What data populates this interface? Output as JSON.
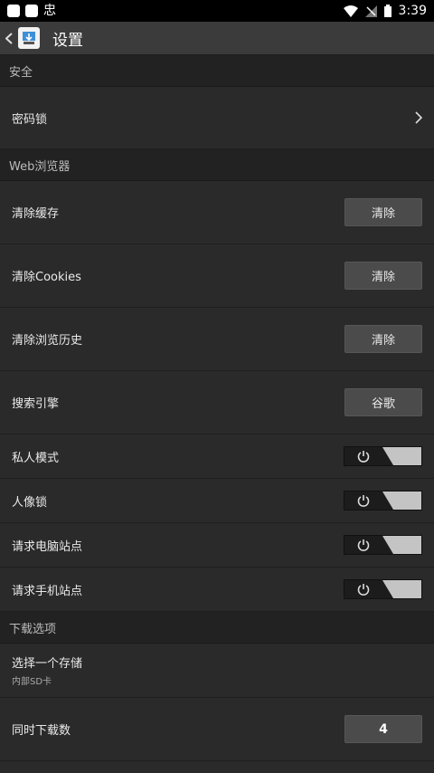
{
  "status_bar": {
    "time": "3:39",
    "notification_glyph": "忠"
  },
  "toolbar": {
    "title": "设置"
  },
  "sections": {
    "security": {
      "header": "安全",
      "password_lock": "密码锁"
    },
    "browser": {
      "header": "Web浏览器",
      "clear_cache": {
        "label": "清除缓存",
        "button": "清除"
      },
      "clear_cookies": {
        "label": "清除Cookies",
        "button": "清除"
      },
      "clear_history": {
        "label": "清除浏览历史",
        "button": "清除"
      },
      "search_engine": {
        "label": "搜索引擎",
        "button": "谷歌"
      },
      "private_mode": {
        "label": "私人模式"
      },
      "portrait_lock": {
        "label": "人像锁"
      },
      "request_desktop": {
        "label": "请求电脑站点"
      },
      "request_mobile": {
        "label": "请求手机站点"
      }
    },
    "download": {
      "header": "下载选项",
      "storage": {
        "label": "选择一个存储",
        "value": "内部SD卡"
      },
      "concurrent": {
        "label": "同时下载数",
        "value": "4"
      }
    }
  },
  "icons": [
    "back-arrow-icon",
    "app-download-icon",
    "chevron-right-icon",
    "power-icon",
    "wifi-icon",
    "signal-icon",
    "battery-icon"
  ],
  "colors": {
    "background": "#2a2a2a",
    "toolbar": "#3b3b3b",
    "section_header": "#222222",
    "button": "#4b4b4b",
    "toggle_knob": "#c4c4c4"
  }
}
